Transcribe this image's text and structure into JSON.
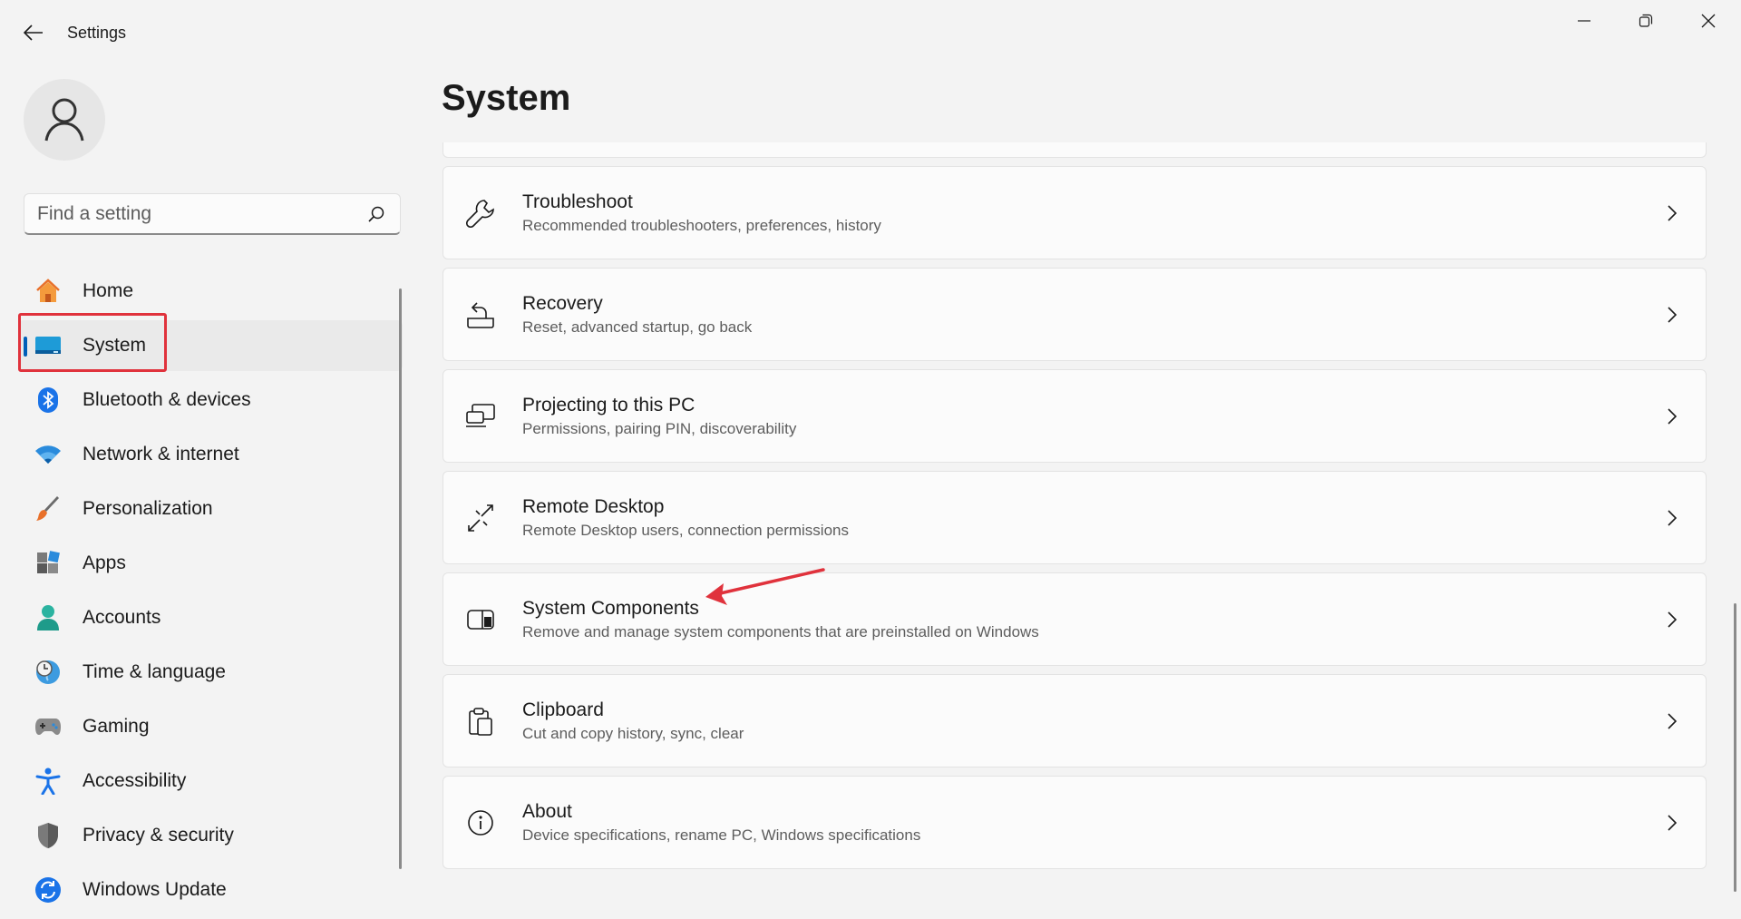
{
  "window": {
    "title": "Settings",
    "controls": {
      "minimize": "minimize-icon",
      "restore": "restore-icon",
      "close": "close-icon"
    }
  },
  "search": {
    "placeholder": "Find a setting"
  },
  "sidebar": {
    "items": [
      {
        "label": "Home",
        "icon": "home-icon"
      },
      {
        "label": "System",
        "icon": "system-icon",
        "selected": true
      },
      {
        "label": "Bluetooth & devices",
        "icon": "bluetooth-icon"
      },
      {
        "label": "Network & internet",
        "icon": "wifi-icon"
      },
      {
        "label": "Personalization",
        "icon": "brush-icon"
      },
      {
        "label": "Apps",
        "icon": "apps-icon"
      },
      {
        "label": "Accounts",
        "icon": "person-icon"
      },
      {
        "label": "Time & language",
        "icon": "clock-globe-icon"
      },
      {
        "label": "Gaming",
        "icon": "gamepad-icon"
      },
      {
        "label": "Accessibility",
        "icon": "accessibility-icon"
      },
      {
        "label": "Privacy & security",
        "icon": "shield-icon"
      },
      {
        "label": "Windows Update",
        "icon": "update-icon"
      }
    ]
  },
  "main": {
    "title": "System",
    "cards": [
      {
        "title": "Troubleshoot",
        "description": "Recommended troubleshooters, preferences, history",
        "icon": "wrench-icon"
      },
      {
        "title": "Recovery",
        "description": "Reset, advanced startup, go back",
        "icon": "recovery-icon"
      },
      {
        "title": "Projecting to this PC",
        "description": "Permissions, pairing PIN, discoverability",
        "icon": "projecting-icon"
      },
      {
        "title": "Remote Desktop",
        "description": "Remote Desktop users, connection permissions",
        "icon": "remote-desktop-icon"
      },
      {
        "title": "System Components",
        "description": "Remove and manage system components that are preinstalled on Windows",
        "icon": "system-components-icon"
      },
      {
        "title": "Clipboard",
        "description": "Cut and copy history, sync, clear",
        "icon": "clipboard-icon"
      },
      {
        "title": "About",
        "description": "Device specifications, rename PC, Windows specifications",
        "icon": "info-icon"
      }
    ]
  },
  "colors": {
    "accent": "#005fb8",
    "highlight_box": "#e0323c",
    "annotation_arrow": "#e0323c"
  }
}
